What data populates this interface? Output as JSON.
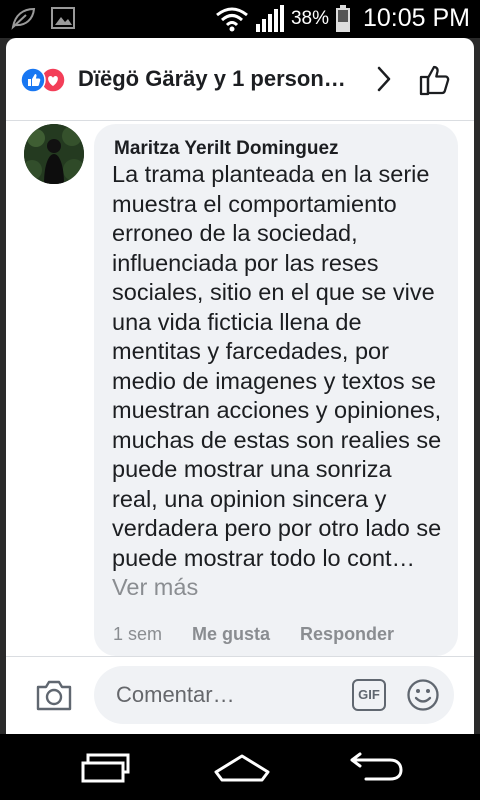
{
  "status_bar": {
    "battery_percent": "38%",
    "time": "10:05 PM"
  },
  "header": {
    "title": "Dïëgö Gäräy y 1 person…",
    "reaction_icons": [
      "like-reaction-icon",
      "love-reaction-icon"
    ],
    "colors": {
      "like": "#1877f2",
      "love": "#f33e58"
    }
  },
  "comment": {
    "author": "Maritza Yerilt Dominguez",
    "text": "La trama planteada en la serie muestra el comportamiento erroneo de la sociedad, influenciada por las reses sociales, sitio en el que se vive una vida ficticia llena de mentitas y farcedades, por medio de imagenes y textos se muestran acciones y opiniones, muchas de estas son realies se puede mostrar una sonriza real, una opinion sincera y verdadera pero por otro lado se puede mostrar todo lo cont…",
    "see_more": "Ver más",
    "time": "1 sem",
    "like_label": "Me gusta",
    "reply_label": "Responder"
  },
  "composer": {
    "placeholder": "Comentar…",
    "gif_label": "GIF"
  }
}
